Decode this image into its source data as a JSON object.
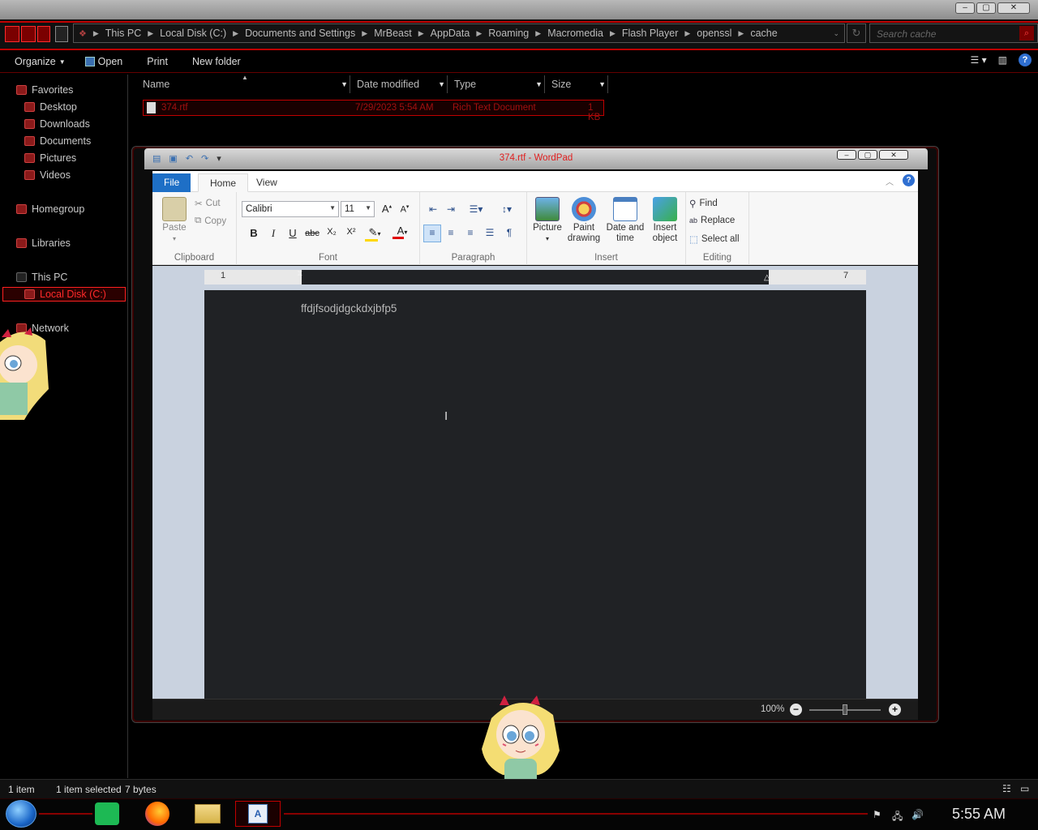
{
  "explorer": {
    "breadcrumb": [
      "This PC",
      "Local Disk (C:)",
      "Documents and Settings",
      "MrBeast",
      "AppData",
      "Roaming",
      "Macromedia",
      "Flash Player",
      "openssl",
      "cache"
    ],
    "search_placeholder": "Search cache",
    "commands": {
      "organize": "Organize",
      "open": "Open",
      "print": "Print",
      "new_folder": "New folder"
    },
    "nav": {
      "favorites": "Favorites",
      "desktop": "Desktop",
      "downloads": "Downloads",
      "documents": "Documents",
      "pictures": "Pictures",
      "videos": "Videos",
      "homegroup": "Homegroup",
      "libraries": "Libraries",
      "this_pc": "This PC",
      "local_disk": "Local Disk (C:)",
      "network": "Network"
    },
    "columns": {
      "name": "Name",
      "date": "Date modified",
      "type": "Type",
      "size": "Size"
    },
    "file": {
      "name": "374.rtf",
      "date": "7/29/2023 5:54 AM",
      "type": "Rich Text Document",
      "size": "1 KB"
    },
    "status": {
      "items": "1 item",
      "selected": "1 item selected",
      "bytes": "7 bytes"
    }
  },
  "wordpad": {
    "title": "374.rtf - WordPad",
    "tabs": {
      "file": "File",
      "home": "Home",
      "view": "View"
    },
    "clipboard": {
      "paste": "Paste",
      "cut": "Cut",
      "copy": "Copy",
      "label": "Clipboard"
    },
    "font": {
      "family": "Calibri",
      "size": "11",
      "label": "Font"
    },
    "paragraph": {
      "label": "Paragraph"
    },
    "insert": {
      "picture": "Picture",
      "paint1": "Paint",
      "paint2": "drawing",
      "date1": "Date and",
      "date2": "time",
      "obj1": "Insert",
      "obj2": "object",
      "label": "Insert"
    },
    "editing": {
      "find": "Find",
      "replace": "Replace",
      "select_all": "Select all",
      "label": "Editing"
    },
    "ruler": {
      "left": "1",
      "right": "7"
    },
    "document_text": "ffdjfsodjdgckdxjbfp5",
    "zoom": "100%"
  },
  "taskbar": {
    "clock": "5:55 AM"
  },
  "colors": {
    "accent_red": "#c00000",
    "file_tab_blue": "#1e6fc6",
    "page_dark": "#202225"
  }
}
